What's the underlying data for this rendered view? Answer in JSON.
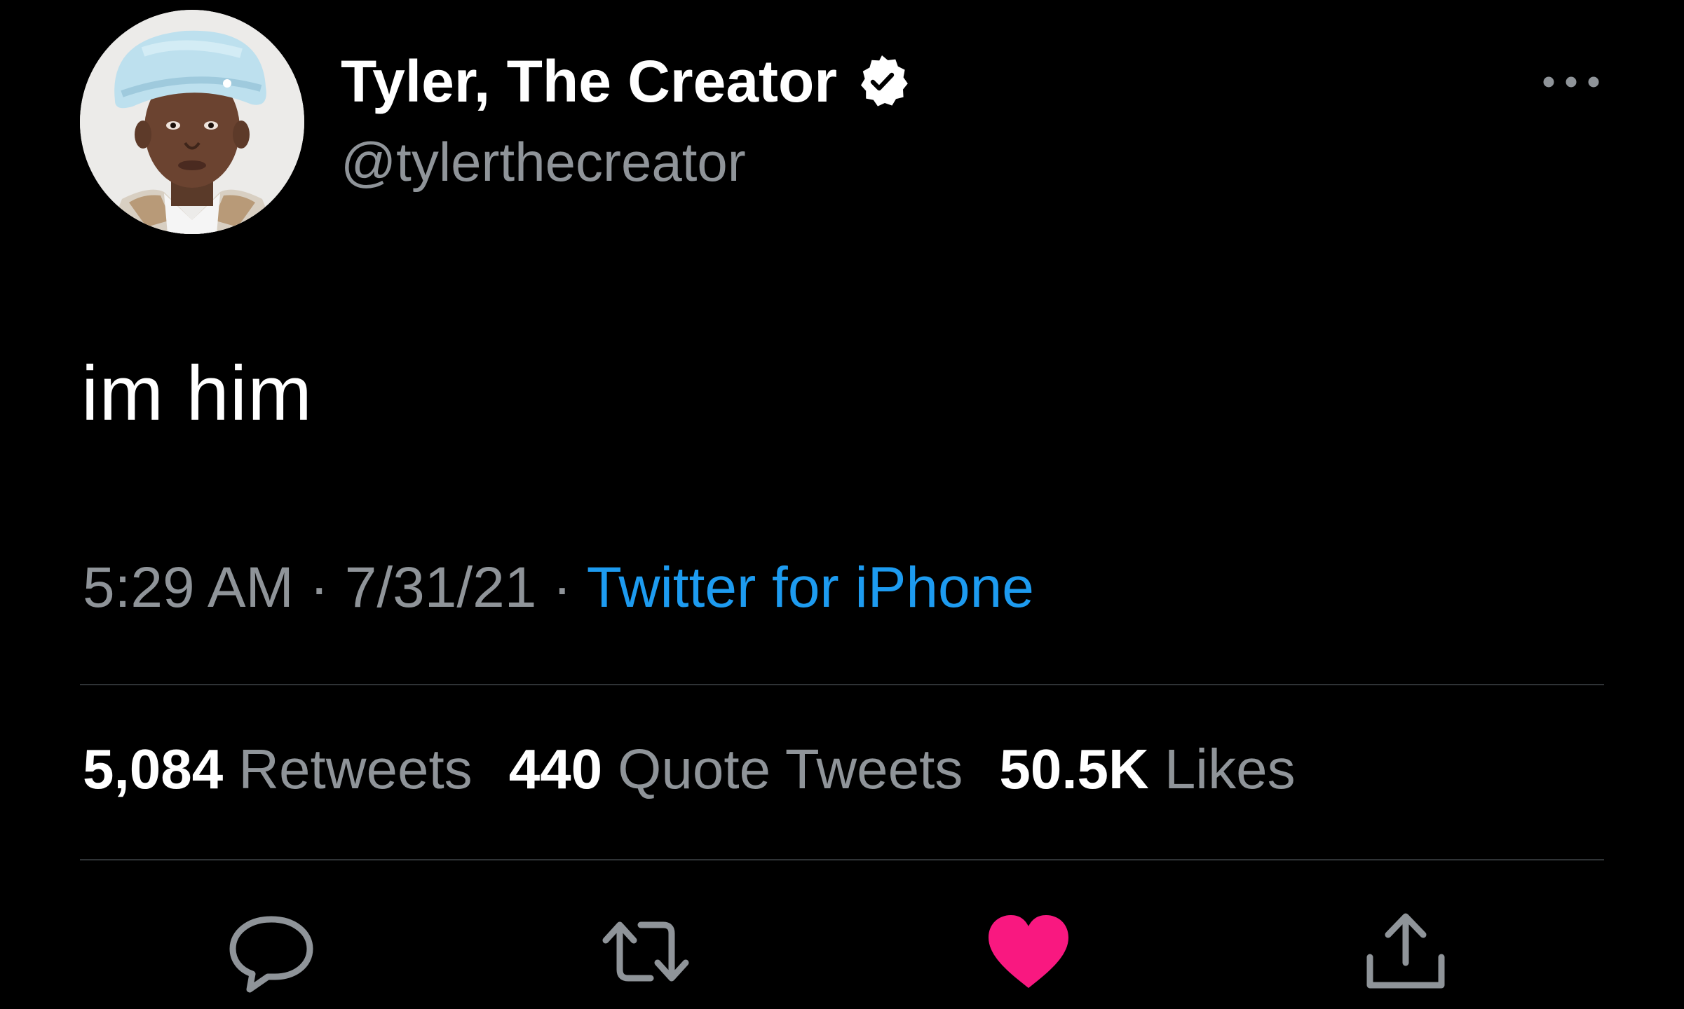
{
  "tweet": {
    "author": {
      "display_name": "Tyler, The Creator",
      "handle": "@tylerthecreator",
      "verified": true
    },
    "text": "im him",
    "time": "5:29 AM",
    "separator": "·",
    "date": "7/31/21",
    "source": "Twitter for iPhone",
    "stats": {
      "retweets_count": "5,084",
      "retweets_label": "Retweets",
      "quotes_count": "440",
      "quotes_label": "Quote Tweets",
      "likes_count": "50.5K",
      "likes_label": "Likes"
    },
    "actions": [
      {
        "icon": "reply-icon"
      },
      {
        "icon": "retweet-icon"
      },
      {
        "icon": "heart-icon",
        "active": true
      },
      {
        "icon": "share-icon"
      }
    ]
  },
  "colors": {
    "background": "#000000",
    "text_primary": "#ffffff",
    "text_secondary": "#8f9499",
    "link": "#1d9bf0",
    "like_active": "#f91880",
    "divider": "#2f3336"
  }
}
